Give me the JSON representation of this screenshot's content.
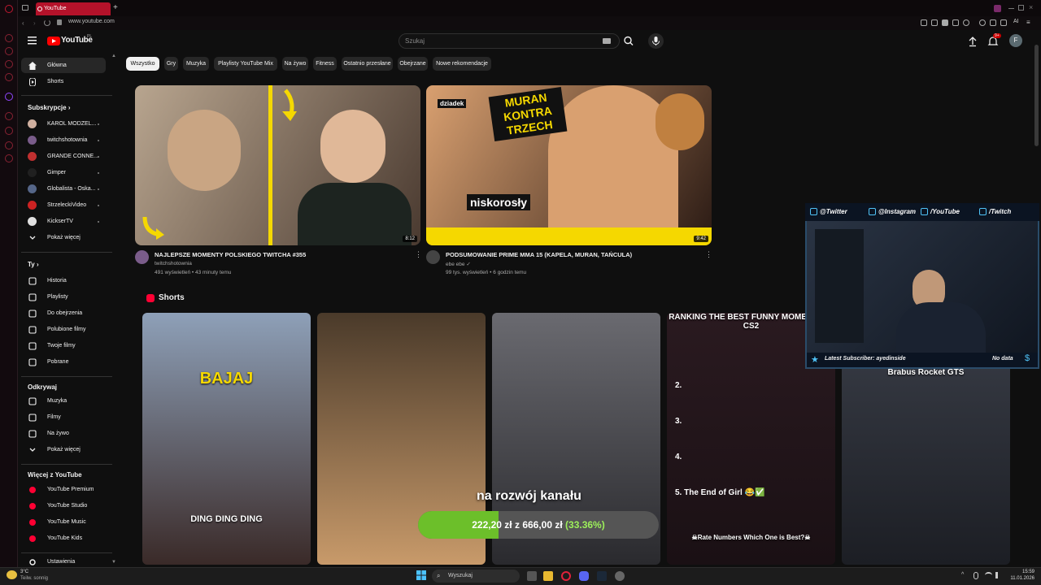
{
  "browser": {
    "tab_title": "YouTube",
    "url": "www.youtube.com",
    "ai_label": "AI"
  },
  "header": {
    "logo_text": "YouTube",
    "logo_region": "PL",
    "search_placeholder": "Szukaj",
    "notification_badge": "9+",
    "account_initial": "F"
  },
  "sidebar": {
    "main": [
      {
        "label": "Główna",
        "icon": "home-icon"
      },
      {
        "label": "Shorts",
        "icon": "shorts-icon"
      }
    ],
    "subscriptions_heading": "Subskrypcje",
    "subscriptions": [
      {
        "label": "KAROL MODZEL...",
        "color": "#d0b0a0"
      },
      {
        "label": "twitchshotownia",
        "color": "#7a5c8a"
      },
      {
        "label": "GRANDE CONNE...",
        "color": "#c03030"
      },
      {
        "label": "Gimper",
        "color": "#202020"
      },
      {
        "label": "Globalista - Oska...",
        "color": "#556688"
      },
      {
        "label": "StrzeleckiVideo",
        "color": "#cc2222"
      },
      {
        "label": "KickserTV",
        "color": "#e0e0e0"
      }
    ],
    "show_more_1": "Pokaż więcej",
    "you_heading": "Ty",
    "you_items": [
      {
        "label": "Historia",
        "icon": "history-icon"
      },
      {
        "label": "Playlisty",
        "icon": "playlist-icon"
      },
      {
        "label": "Do obejrzenia",
        "icon": "clock-icon"
      },
      {
        "label": "Polubione filmy",
        "icon": "like-icon"
      },
      {
        "label": "Twoje filmy",
        "icon": "your-videos-icon"
      },
      {
        "label": "Pobrane",
        "icon": "download-icon"
      }
    ],
    "explore_heading": "Odkrywaj",
    "explore_items": [
      {
        "label": "Muzyka",
        "icon": "music-icon"
      },
      {
        "label": "Filmy",
        "icon": "film-icon"
      },
      {
        "label": "Na żywo",
        "icon": "live-icon"
      }
    ],
    "show_more_2": "Pokaż więcej",
    "more_heading": "Więcej z YouTube",
    "more_items": [
      {
        "label": "YouTube Premium",
        "icon": "youtube-premium-icon"
      },
      {
        "label": "YouTube Studio",
        "icon": "youtube-studio-icon"
      },
      {
        "label": "YouTube Music",
        "icon": "youtube-music-icon"
      },
      {
        "label": "YouTube Kids",
        "icon": "youtube-kids-icon"
      }
    ],
    "settings": "Ustawienia"
  },
  "chips": [
    "Wszystko",
    "Gry",
    "Muzyka",
    "Playlisty YouTube Mix",
    "Na żywo",
    "Fitness",
    "Ostatnio przesłane",
    "Obejrzane",
    "Nowe rekomendacje"
  ],
  "videos": [
    {
      "title": "NAJLEPSZE MOMENTY POLSKIEGO TWITCHA #355",
      "channel": "twitchshotownia",
      "meta": "491 wyświetleń • 43 minuty temu",
      "duration": "8:12",
      "thumb_colors": [
        "#b8a58f",
        "#4a3a30"
      ]
    },
    {
      "title": "PODSUMOWANIE PRIME MMA 15 (KAPELA, MURAN, TAŃCULA)",
      "channel": "ebe ebe",
      "meta": "99 tys. wyświetleń • 6 godzin temu",
      "duration": "9:42",
      "thumb_colors": [
        "#d9a070",
        "#2a1a14"
      ],
      "thumb_text": {
        "top": "MURAN KONTRA TRZECH",
        "left": "dziadek",
        "bottom": "niskorosły"
      }
    }
  ],
  "shorts_heading": "Shorts",
  "shorts": [
    {
      "color1": "#8ea0b8",
      "color2": "#3a2a28",
      "caption": "DING DING DING",
      "top_text": "BAJAJ"
    },
    {
      "color1": "#4a3a2a",
      "color2": "#c89a6a",
      "caption": "",
      "top_text": ""
    },
    {
      "color1": "#6a6a70",
      "color2": "#2a2a2e",
      "caption": "",
      "top_text": ""
    },
    {
      "color1": "#2a1a20",
      "color2": "#1a1014",
      "caption": "☠Rate Numbers Which One is Best?☠",
      "top_text": "RANKING THE BEST FUNNY MOMENTS IN CS2",
      "list": [
        "2.",
        "3.",
        "4.",
        "5. The End of Girl 😂✅"
      ]
    },
    {
      "color1": "#3a3e48",
      "color2": "#1c1e24",
      "caption": "",
      "top_text": "Brabus Rocket GTS"
    }
  ],
  "stream_overlay": {
    "socials": [
      "@Twitter",
      "@Instagram",
      "/YouTube",
      "/Twitch"
    ],
    "latest_sub": "Latest Subscriber: ayedinside",
    "no_data": "No data",
    "donation_text": "na rozwój kanału",
    "donation_current": "222,20 zł",
    "donation_sep": "z",
    "donation_goal": "666,00 zł",
    "donation_percent": "(33.36%)",
    "donation_progress": 0.3336
  },
  "taskbar": {
    "weather_temp": "3°C",
    "weather_desc": "Teilw. sonnig",
    "search": "Wyszukaj",
    "time": "15:59",
    "date": "11.01.2026"
  }
}
